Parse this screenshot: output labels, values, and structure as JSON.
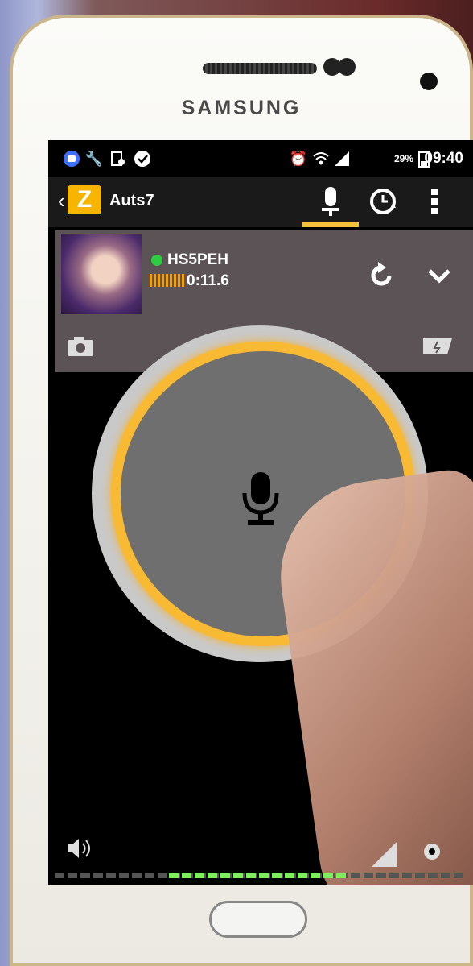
{
  "device": {
    "brand": "SAMSUNG"
  },
  "status_bar": {
    "battery": "29%",
    "time": "09:40"
  },
  "app": {
    "channel_name": "Auts7",
    "logo_letter": "Z",
    "accent_color": "#f5c03a",
    "active_tab": "mic",
    "tabs": [
      "mic-icon",
      "history-icon",
      "more-vert-icon"
    ]
  },
  "message": {
    "username": "HS5PEH",
    "duration": "0:11.6",
    "online": true
  },
  "ptt": {
    "ring_color": "#f8b933"
  },
  "meter": {
    "level": 0.43,
    "active_color": "#7bf05a"
  }
}
